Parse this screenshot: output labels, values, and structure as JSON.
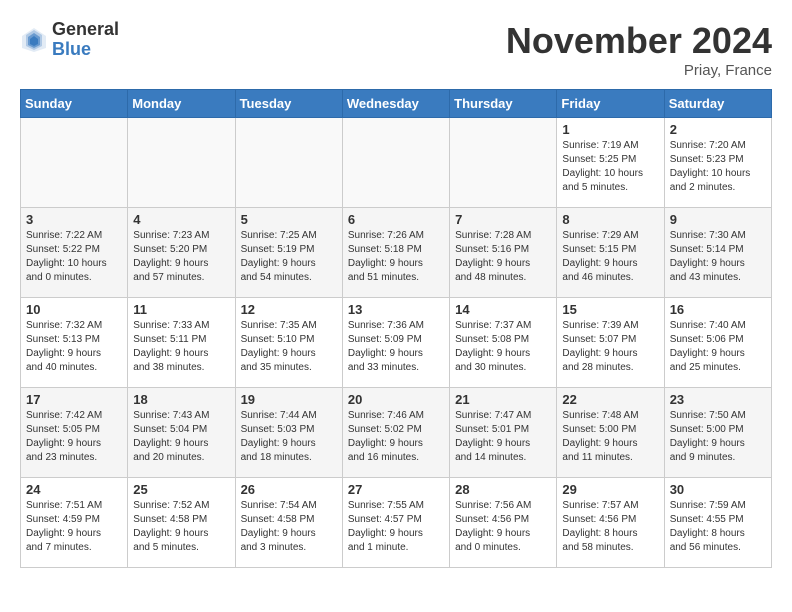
{
  "header": {
    "logo_general": "General",
    "logo_blue": "Blue",
    "month_title": "November 2024",
    "location": "Priay, France"
  },
  "weekdays": [
    "Sunday",
    "Monday",
    "Tuesday",
    "Wednesday",
    "Thursday",
    "Friday",
    "Saturday"
  ],
  "weeks": [
    [
      {
        "day": "",
        "info": ""
      },
      {
        "day": "",
        "info": ""
      },
      {
        "day": "",
        "info": ""
      },
      {
        "day": "",
        "info": ""
      },
      {
        "day": "",
        "info": ""
      },
      {
        "day": "1",
        "info": "Sunrise: 7:19 AM\nSunset: 5:25 PM\nDaylight: 10 hours\nand 5 minutes."
      },
      {
        "day": "2",
        "info": "Sunrise: 7:20 AM\nSunset: 5:23 PM\nDaylight: 10 hours\nand 2 minutes."
      }
    ],
    [
      {
        "day": "3",
        "info": "Sunrise: 7:22 AM\nSunset: 5:22 PM\nDaylight: 10 hours\nand 0 minutes."
      },
      {
        "day": "4",
        "info": "Sunrise: 7:23 AM\nSunset: 5:20 PM\nDaylight: 9 hours\nand 57 minutes."
      },
      {
        "day": "5",
        "info": "Sunrise: 7:25 AM\nSunset: 5:19 PM\nDaylight: 9 hours\nand 54 minutes."
      },
      {
        "day": "6",
        "info": "Sunrise: 7:26 AM\nSunset: 5:18 PM\nDaylight: 9 hours\nand 51 minutes."
      },
      {
        "day": "7",
        "info": "Sunrise: 7:28 AM\nSunset: 5:16 PM\nDaylight: 9 hours\nand 48 minutes."
      },
      {
        "day": "8",
        "info": "Sunrise: 7:29 AM\nSunset: 5:15 PM\nDaylight: 9 hours\nand 46 minutes."
      },
      {
        "day": "9",
        "info": "Sunrise: 7:30 AM\nSunset: 5:14 PM\nDaylight: 9 hours\nand 43 minutes."
      }
    ],
    [
      {
        "day": "10",
        "info": "Sunrise: 7:32 AM\nSunset: 5:13 PM\nDaylight: 9 hours\nand 40 minutes."
      },
      {
        "day": "11",
        "info": "Sunrise: 7:33 AM\nSunset: 5:11 PM\nDaylight: 9 hours\nand 38 minutes."
      },
      {
        "day": "12",
        "info": "Sunrise: 7:35 AM\nSunset: 5:10 PM\nDaylight: 9 hours\nand 35 minutes."
      },
      {
        "day": "13",
        "info": "Sunrise: 7:36 AM\nSunset: 5:09 PM\nDaylight: 9 hours\nand 33 minutes."
      },
      {
        "day": "14",
        "info": "Sunrise: 7:37 AM\nSunset: 5:08 PM\nDaylight: 9 hours\nand 30 minutes."
      },
      {
        "day": "15",
        "info": "Sunrise: 7:39 AM\nSunset: 5:07 PM\nDaylight: 9 hours\nand 28 minutes."
      },
      {
        "day": "16",
        "info": "Sunrise: 7:40 AM\nSunset: 5:06 PM\nDaylight: 9 hours\nand 25 minutes."
      }
    ],
    [
      {
        "day": "17",
        "info": "Sunrise: 7:42 AM\nSunset: 5:05 PM\nDaylight: 9 hours\nand 23 minutes."
      },
      {
        "day": "18",
        "info": "Sunrise: 7:43 AM\nSunset: 5:04 PM\nDaylight: 9 hours\nand 20 minutes."
      },
      {
        "day": "19",
        "info": "Sunrise: 7:44 AM\nSunset: 5:03 PM\nDaylight: 9 hours\nand 18 minutes."
      },
      {
        "day": "20",
        "info": "Sunrise: 7:46 AM\nSunset: 5:02 PM\nDaylight: 9 hours\nand 16 minutes."
      },
      {
        "day": "21",
        "info": "Sunrise: 7:47 AM\nSunset: 5:01 PM\nDaylight: 9 hours\nand 14 minutes."
      },
      {
        "day": "22",
        "info": "Sunrise: 7:48 AM\nSunset: 5:00 PM\nDaylight: 9 hours\nand 11 minutes."
      },
      {
        "day": "23",
        "info": "Sunrise: 7:50 AM\nSunset: 5:00 PM\nDaylight: 9 hours\nand 9 minutes."
      }
    ],
    [
      {
        "day": "24",
        "info": "Sunrise: 7:51 AM\nSunset: 4:59 PM\nDaylight: 9 hours\nand 7 minutes."
      },
      {
        "day": "25",
        "info": "Sunrise: 7:52 AM\nSunset: 4:58 PM\nDaylight: 9 hours\nand 5 minutes."
      },
      {
        "day": "26",
        "info": "Sunrise: 7:54 AM\nSunset: 4:58 PM\nDaylight: 9 hours\nand 3 minutes."
      },
      {
        "day": "27",
        "info": "Sunrise: 7:55 AM\nSunset: 4:57 PM\nDaylight: 9 hours\nand 1 minute."
      },
      {
        "day": "28",
        "info": "Sunrise: 7:56 AM\nSunset: 4:56 PM\nDaylight: 9 hours\nand 0 minutes."
      },
      {
        "day": "29",
        "info": "Sunrise: 7:57 AM\nSunset: 4:56 PM\nDaylight: 8 hours\nand 58 minutes."
      },
      {
        "day": "30",
        "info": "Sunrise: 7:59 AM\nSunset: 4:55 PM\nDaylight: 8 hours\nand 56 minutes."
      }
    ]
  ]
}
